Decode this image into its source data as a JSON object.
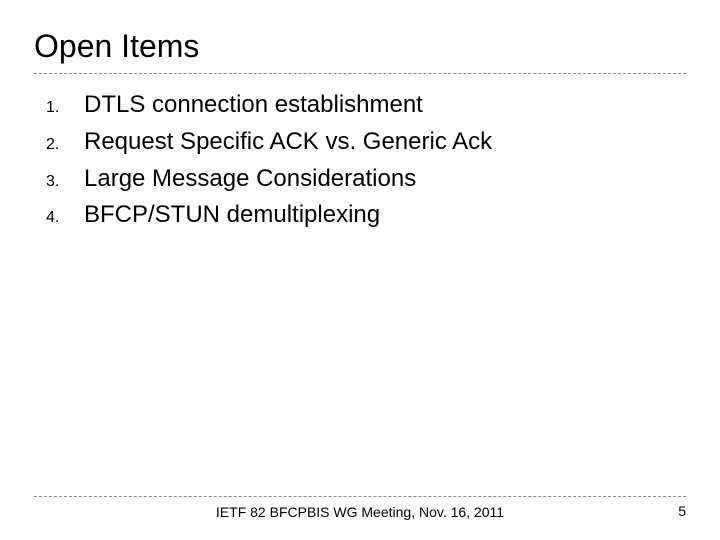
{
  "title": "Open Items",
  "items": [
    {
      "num": "1.",
      "text": "DTLS connection establishment"
    },
    {
      "num": "2.",
      "text": "Request Specific ACK vs. Generic Ack"
    },
    {
      "num": "3.",
      "text": "Large Message Considerations"
    },
    {
      "num": "4.",
      "text": "BFCP/STUN demultiplexing"
    }
  ],
  "footer": {
    "text": "IETF 82 BFCPBIS WG Meeting, Nov. 16, 2011",
    "page": "5"
  }
}
